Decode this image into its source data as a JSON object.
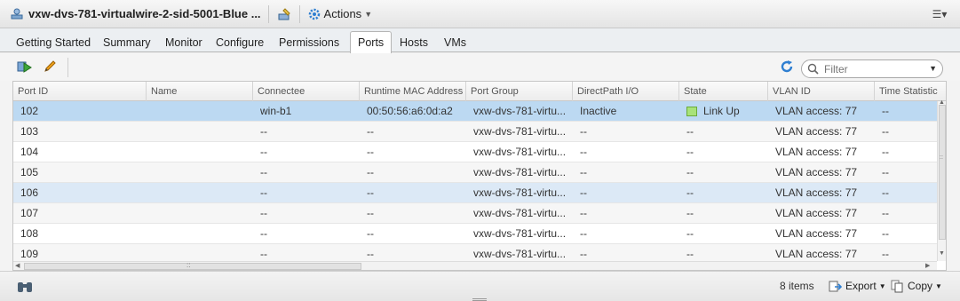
{
  "header": {
    "title": "vxw-dvs-781-virtualwire-2-sid-5001-Blue ...",
    "actions_label": "Actions"
  },
  "tabs": [
    {
      "label": "Getting Started"
    },
    {
      "label": "Summary"
    },
    {
      "label": "Monitor"
    },
    {
      "label": "Configure"
    },
    {
      "label": "Permissions"
    },
    {
      "label": "Ports",
      "active": true
    },
    {
      "label": "Hosts"
    },
    {
      "label": "VMs"
    }
  ],
  "filter": {
    "placeholder": "Filter"
  },
  "table": {
    "columns": [
      "Port ID",
      "Name",
      "Connectee",
      "Runtime MAC Address",
      "Port Group",
      "DirectPath I/O",
      "State",
      "VLAN ID",
      "Time Statistic"
    ],
    "rows": [
      [
        "102",
        "",
        "win-b1",
        "00:50:56:a6:0d:a2",
        "vxw-dvs-781-virtu...",
        "Inactive",
        "Link Up",
        "VLAN access: 77",
        "--"
      ],
      [
        "103",
        "",
        "--",
        "--",
        "vxw-dvs-781-virtu...",
        "--",
        "--",
        "VLAN access: 77",
        "--"
      ],
      [
        "104",
        "",
        "--",
        "--",
        "vxw-dvs-781-virtu...",
        "--",
        "--",
        "VLAN access: 77",
        "--"
      ],
      [
        "105",
        "",
        "--",
        "--",
        "vxw-dvs-781-virtu...",
        "--",
        "--",
        "VLAN access: 77",
        "--"
      ],
      [
        "106",
        "",
        "--",
        "--",
        "vxw-dvs-781-virtu...",
        "--",
        "--",
        "VLAN access: 77",
        "--"
      ],
      [
        "107",
        "",
        "--",
        "--",
        "vxw-dvs-781-virtu...",
        "--",
        "--",
        "VLAN access: 77",
        "--"
      ],
      [
        "108",
        "",
        "--",
        "--",
        "vxw-dvs-781-virtu...",
        "--",
        "--",
        "VLAN access: 77",
        "--"
      ],
      [
        "109",
        "",
        "--",
        "--",
        "vxw-dvs-781-virtu...",
        "--",
        "--",
        "VLAN access: 77",
        "--"
      ]
    ]
  },
  "footer": {
    "item_count": "8 items",
    "export_label": "Export",
    "copy_label": "Copy"
  },
  "icons": {
    "title": "distributed-portgroup-icon",
    "add_vm": "add-port-icon",
    "edit": "pencil-icon",
    "refresh": "refresh-icon",
    "filter": "search-icon",
    "find": "binoculars-icon",
    "export": "export-icon",
    "copy": "copy-icon"
  },
  "colors": {
    "selected_row": "#bcd9f2",
    "highlight_row": "#dce9f6",
    "link_up": "#a8e27a",
    "accent": "#2f7fd1"
  }
}
